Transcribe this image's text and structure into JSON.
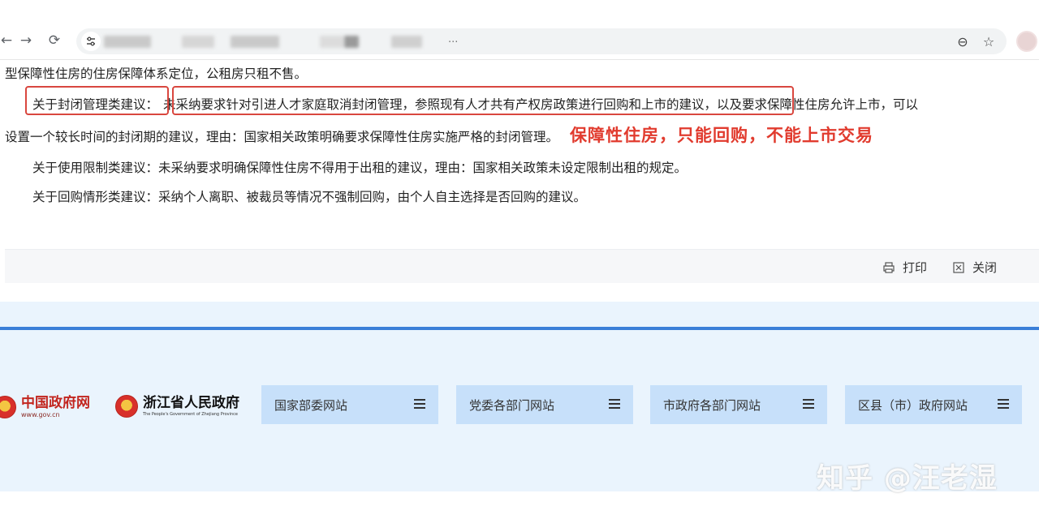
{
  "browser": {
    "back_glyph": "←",
    "forward_glyph": "→",
    "reload_glyph": "⟳",
    "url_truncation": "...",
    "zoom_glyph": "⊖",
    "bookmark_glyph": "☆"
  },
  "article": {
    "line1": "型保障性住房的住房保障体系定位，公租房只租不售。",
    "p2_label": "关于封闭管理类建议：",
    "p2_highlight": "未采纳要求针对引进人才家庭取消封闭管理，参照现有人才共有产权房政策进行回购和上市的建议，",
    "p2_rest": "以及要求保障性住房允许上市，可以",
    "p2_line2": "设置一个较长时间的封闭期的建议，理由：国家相关政策明确要求保障性住房实施严格的封闭管理。",
    "p2_annotation": "保障性住房，只能回购，不能上市交易",
    "p3": "关于使用限制类建议：未采纳要求明确保障性住房不得用于出租的建议，理由：国家相关政策未设定限制出租的规定。",
    "p4": "关于回购情形类建议：采纳个人离职、被裁员等情况不强制回购，由个人自主选择是否回购的建议。"
  },
  "toolbar": {
    "print_label": "打印",
    "close_label": "关闭"
  },
  "footer": {
    "logo1_title": "中国政府网",
    "logo1_sub": "www.gov.cn",
    "logo2_title": "浙江省人民政府",
    "logo2_sub": "The People's Government of Zhejiang Province",
    "portals": [
      {
        "label": "国家部委网站"
      },
      {
        "label": "党委各部门网站"
      },
      {
        "label": "市政府各部门网站"
      },
      {
        "label": "区县（市）政府网站"
      }
    ]
  },
  "watermark": "知乎 @汪老湿",
  "colors": {
    "annotation_red": "#e13b2e",
    "footer_bg": "#eaf4fd",
    "footer_bar": "#3a7fd8",
    "portal_bg": "#c7e0fa"
  }
}
